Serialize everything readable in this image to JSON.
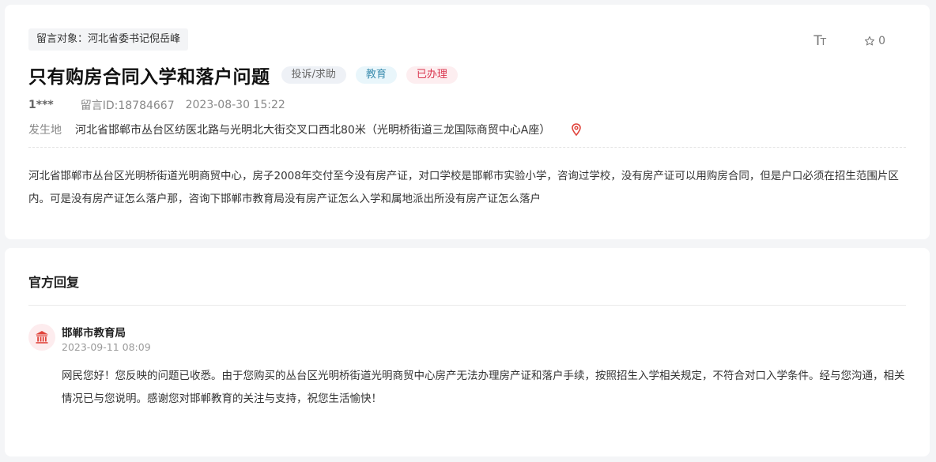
{
  "message": {
    "target": "留言对象：河北省委书记倪岳峰",
    "title": "只有购房合同入学和落户问题",
    "tags": {
      "category": "投诉/求助",
      "field": "教育",
      "status": "已办理"
    },
    "user": "1***",
    "message_id": "留言ID:18784667",
    "time": "2023-08-30 15:22",
    "location_label": "发生地",
    "location": "河北省邯郸市丛台区纺医北路与光明北大街交叉口西北80米（光明桥街道三龙国际商贸中心A座）",
    "body": "河北省邯郸市丛台区光明桥街道光明商贸中心，房子2008年交付至今没有房产证，对口学校是邯郸市实验小学，咨询过学校，没有房产证可以用购房合同，但是户口必须在招生范围片区内。可是没有房产证怎么落户那，咨询下邯郸市教育局没有房产证怎么入学和属地派出所没有房产证怎么落户"
  },
  "toolbar": {
    "font_size_big": "T",
    "font_size_small": "T",
    "favorite_count": "0",
    "icons": [
      "font-size-icon",
      "star-icon",
      "location-pin-icon"
    ]
  },
  "reply": {
    "section_title": "官方回复",
    "org_name": "邯郸市教育局",
    "org_icon": "government-building-icon",
    "time": "2023-09-11 08:09",
    "text": "网民您好！您反映的问题已收悉。由于您购买的丛台区光明桥街道光明商贸中心房产无法办理房产证和落户手续，按照招生入学相关规定，不符合对口入学条件。经与您沟通，相关情况已与您说明。感谢您对邯郸教育的关注与支持，祝您生活愉快！"
  },
  "colors": {
    "status_red": "#d9344d",
    "field_blue": "#3f8fb0",
    "pin_red": "#e0433b"
  }
}
